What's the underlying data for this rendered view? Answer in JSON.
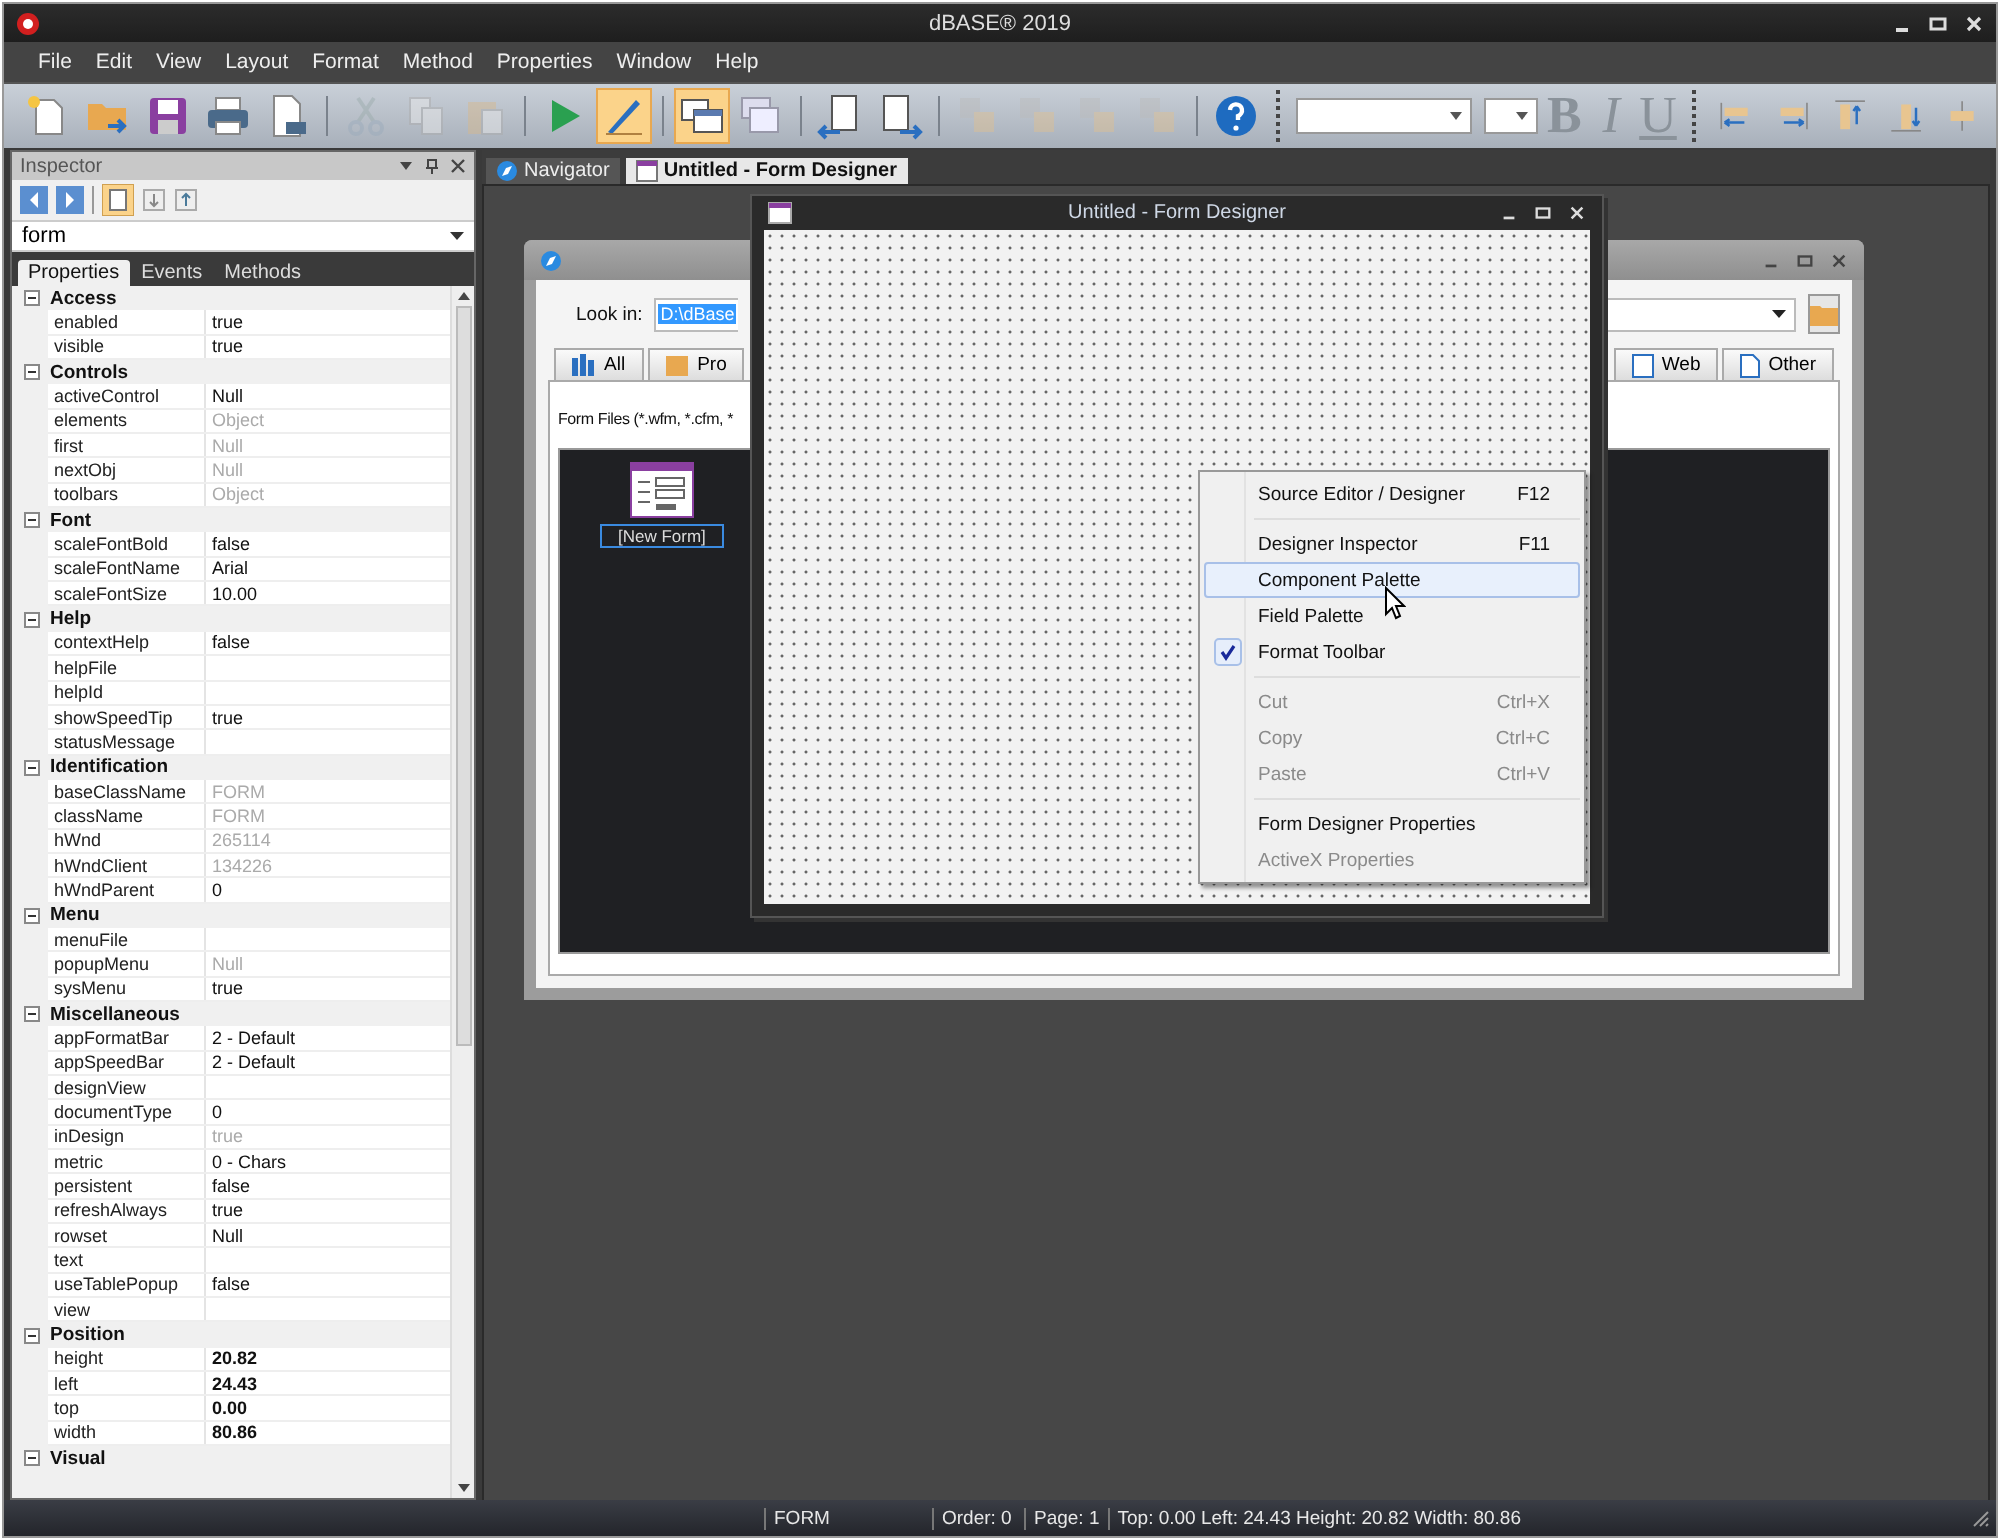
{
  "window": {
    "title": "dBASE® 2019"
  },
  "menu": [
    "File",
    "Edit",
    "View",
    "Layout",
    "Format",
    "Method",
    "Properties",
    "Window",
    "Help"
  ],
  "toolbar": [
    [
      {
        "kind": "new",
        "selected": false,
        "disabled": false
      },
      {
        "kind": "open",
        "selected": false,
        "disabled": false
      },
      {
        "kind": "save",
        "selected": false,
        "disabled": false
      },
      {
        "kind": "print",
        "selected": false,
        "disabled": false
      },
      {
        "kind": "preview",
        "selected": false,
        "disabled": false
      }
    ],
    [
      {
        "kind": "cut",
        "selected": false,
        "disabled": true
      },
      {
        "kind": "copy",
        "selected": false,
        "disabled": true
      },
      {
        "kind": "paste",
        "selected": false,
        "disabled": true
      }
    ],
    [
      {
        "kind": "run",
        "selected": false,
        "disabled": false
      },
      {
        "kind": "design",
        "selected": true,
        "disabled": false
      }
    ],
    [
      {
        "kind": "tile",
        "selected": true,
        "disabled": false
      },
      {
        "kind": "cascade",
        "selected": false,
        "disabled": false
      }
    ],
    [
      {
        "kind": "prev",
        "selected": false,
        "disabled": false
      },
      {
        "kind": "next",
        "selected": false,
        "disabled": false
      }
    ],
    [
      {
        "kind": "order",
        "selected": false,
        "disabled": true
      },
      {
        "kind": "order",
        "selected": false,
        "disabled": true
      },
      {
        "kind": "order",
        "selected": false,
        "disabled": true
      },
      {
        "kind": "order",
        "selected": false,
        "disabled": true
      }
    ],
    [
      {
        "kind": "help",
        "selected": false,
        "disabled": false
      }
    ]
  ],
  "format_bar": {
    "style_buttons": [
      {
        "label": "B",
        "kind": "bold",
        "disabled": true
      },
      {
        "label": "I",
        "kind": "italic",
        "disabled": true
      },
      {
        "label": "U",
        "kind": "underline",
        "disabled": true
      }
    ]
  },
  "inspector": {
    "title": "Inspector",
    "object": "form",
    "tabs": [
      {
        "label": "Properties",
        "selected": true
      },
      {
        "label": "Events",
        "selected": false
      },
      {
        "label": "Methods",
        "selected": false
      }
    ],
    "groups": [
      {
        "name": "Access",
        "expanded": true,
        "props": [
          {
            "name": "enabled",
            "value": "true",
            "readonly": false,
            "bold": false
          },
          {
            "name": "visible",
            "value": "true",
            "readonly": false,
            "bold": false
          }
        ]
      },
      {
        "name": "Controls",
        "expanded": true,
        "props": [
          {
            "name": "activeControl",
            "value": "Null",
            "readonly": false,
            "bold": false
          },
          {
            "name": "elements",
            "value": "Object",
            "readonly": true,
            "bold": false
          },
          {
            "name": "first",
            "value": "Null",
            "readonly": true,
            "bold": false
          },
          {
            "name": "nextObj",
            "value": "Null",
            "readonly": true,
            "bold": false
          },
          {
            "name": "toolbars",
            "value": "Object",
            "readonly": true,
            "bold": false
          }
        ]
      },
      {
        "name": "Font",
        "expanded": true,
        "props": [
          {
            "name": "scaleFontBold",
            "value": "false",
            "readonly": false,
            "bold": false
          },
          {
            "name": "scaleFontName",
            "value": "Arial",
            "readonly": false,
            "bold": false
          },
          {
            "name": "scaleFontSize",
            "value": "10.00",
            "readonly": false,
            "bold": false
          }
        ]
      },
      {
        "name": "Help",
        "expanded": true,
        "props": [
          {
            "name": "contextHelp",
            "value": "false",
            "readonly": false,
            "bold": false
          },
          {
            "name": "helpFile"
          },
          {
            "name": "helpId"
          },
          {
            "name": "showSpeedTip",
            "value": "true",
            "readonly": false,
            "bold": false
          },
          {
            "name": "statusMessage"
          }
        ]
      },
      {
        "name": "Identification",
        "expanded": true,
        "props": [
          {
            "name": "baseClassName",
            "value": "FORM",
            "readonly": true,
            "bold": false
          },
          {
            "name": "className",
            "value": "FORM",
            "readonly": true,
            "bold": false
          },
          {
            "name": "hWnd",
            "value": "265114",
            "readonly": true,
            "bold": false
          },
          {
            "name": "hWndClient",
            "value": "134226",
            "readonly": true,
            "bold": false
          },
          {
            "name": "hWndParent",
            "value": "0",
            "readonly": false,
            "bold": false
          }
        ]
      },
      {
        "name": "Menu",
        "expanded": true,
        "props": [
          {
            "name": "menuFile"
          },
          {
            "name": "popupMenu",
            "value": "Null",
            "readonly": true,
            "bold": false
          },
          {
            "name": "sysMenu",
            "value": "true",
            "readonly": false,
            "bold": false
          }
        ]
      },
      {
        "name": "Miscellaneous",
        "expanded": true,
        "props": [
          {
            "name": "appFormatBar",
            "value": "2 - Default",
            "readonly": false,
            "bold": false
          },
          {
            "name": "appSpeedBar",
            "value": "2 - Default",
            "readonly": false,
            "bold": false
          },
          {
            "name": "designView"
          },
          {
            "name": "documentType",
            "value": "0",
            "readonly": false,
            "bold": false
          },
          {
            "name": "inDesign",
            "value": "true",
            "readonly": true,
            "bold": false
          },
          {
            "name": "metric",
            "value": "0 - Chars",
            "readonly": false,
            "bold": false
          },
          {
            "name": "persistent",
            "value": "false",
            "readonly": false,
            "bold": false
          },
          {
            "name": "refreshAlways",
            "value": "true",
            "readonly": false,
            "bold": false
          },
          {
            "name": "rowset",
            "value": "Null",
            "readonly": false,
            "bold": false
          },
          {
            "name": "text"
          },
          {
            "name": "useTablePopup",
            "value": "false",
            "readonly": false,
            "bold": false
          },
          {
            "name": "view"
          }
        ]
      },
      {
        "name": "Position",
        "expanded": true,
        "props": [
          {
            "name": "height",
            "value": "20.82",
            "readonly": false,
            "bold": true
          },
          {
            "name": "left",
            "value": "24.43",
            "readonly": false,
            "bold": true
          },
          {
            "name": "top",
            "value": "0.00",
            "readonly": false,
            "bold": true
          },
          {
            "name": "width",
            "value": "80.86",
            "readonly": false,
            "bold": true
          }
        ]
      },
      {
        "name": "Visual",
        "expanded": true
      }
    ]
  },
  "doc_tabs": [
    {
      "label": "Navigator",
      "kind": "navigator",
      "selected": false
    },
    {
      "label": "Untitled - Form Designer",
      "kind": "designer",
      "selected": true
    }
  ],
  "navigator": {
    "look_in_label": "Look in:",
    "path": "D:\\dBase",
    "tabs_left": [
      {
        "label": "All",
        "kind": "all"
      },
      {
        "label": "Pro",
        "kind": "project"
      }
    ],
    "tabs_right": [
      {
        "label": "Web",
        "kind": "web"
      },
      {
        "label": "Other",
        "kind": "other"
      }
    ],
    "filter": "Form Files (*.wfm, *.cfm, *",
    "files": [
      {
        "label": "[New Form]",
        "selected": true
      }
    ]
  },
  "designer": {
    "title": "Untitled - Form Designer"
  },
  "context_menu": [
    {
      "kind": "item",
      "label": "Source Editor / Designer",
      "shortcut": "F12",
      "disabled": false,
      "checked": false,
      "selected": false
    },
    {
      "kind": "separator"
    },
    {
      "kind": "item",
      "label": "Designer Inspector",
      "shortcut": "F11",
      "disabled": false,
      "checked": false,
      "selected": false
    },
    {
      "kind": "item",
      "label": "Component Palette",
      "disabled": false,
      "checked": false,
      "selected": true
    },
    {
      "kind": "item",
      "label": "Field Palette",
      "disabled": false,
      "checked": false,
      "selected": false
    },
    {
      "kind": "item",
      "label": "Format Toolbar",
      "disabled": false,
      "checked": true,
      "selected": false
    },
    {
      "kind": "separator"
    },
    {
      "kind": "item",
      "label": "Cut",
      "shortcut": "Ctrl+X",
      "disabled": true,
      "checked": false,
      "selected": false
    },
    {
      "kind": "item",
      "label": "Copy",
      "shortcut": "Ctrl+C",
      "disabled": true,
      "checked": false,
      "selected": false
    },
    {
      "kind": "item",
      "label": "Paste",
      "shortcut": "Ctrl+V",
      "disabled": true,
      "checked": false,
      "selected": false
    },
    {
      "kind": "separator"
    },
    {
      "kind": "item",
      "label": "Form Designer Properties",
      "disabled": false,
      "checked": false,
      "selected": false
    },
    {
      "kind": "item",
      "label": "ActiveX Properties",
      "disabled": true,
      "checked": false,
      "selected": false
    }
  ],
  "status_bar": [
    "FORM",
    "Order: 0",
    "Page: 1",
    "Top: 0.00 Left: 24.43 Height: 20.82 Width: 80.86"
  ]
}
